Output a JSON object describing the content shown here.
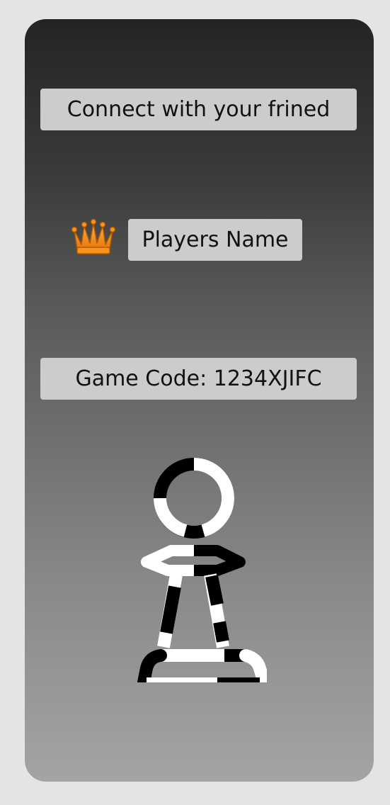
{
  "header": {
    "title": "Connect with your frined"
  },
  "player": {
    "name_label": "Players Name",
    "crown_icon": "crown-icon"
  },
  "game": {
    "code_text": "Game Code: 1234XJIFC"
  },
  "logo": {
    "icon": "chess-pawn-icon"
  },
  "colors": {
    "crown_fill": "#f7941d",
    "box_bg": "#cccccc",
    "gradient_top": "#242424",
    "gradient_bottom": "#a4a4a4"
  }
}
